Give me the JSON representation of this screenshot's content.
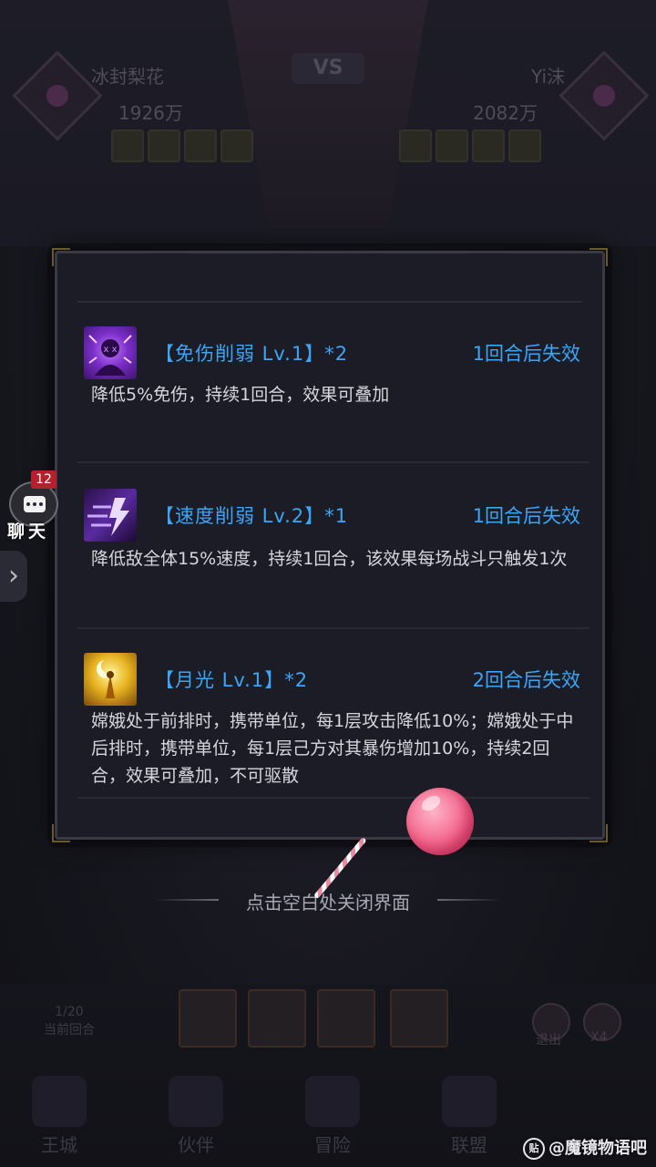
{
  "background": {
    "left_player": {
      "name": "冰封梨花",
      "power": "1926万"
    },
    "right_player": {
      "name": "Yi沫",
      "power": "2082万"
    },
    "vs_label": "VS",
    "round": {
      "count": "1/20",
      "label": "当前回合"
    },
    "controls": [
      {
        "label": "退出"
      },
      {
        "label": "X4"
      }
    ],
    "nav": [
      {
        "label": "王城"
      },
      {
        "label": "伙伴"
      },
      {
        "label": "冒险"
      },
      {
        "label": "联盟"
      }
    ]
  },
  "buffs": [
    {
      "icon": "shield-break-icon",
      "name": "【免伤削弱 Lv.1】*2",
      "duration": "1回合后失效",
      "description": "降低5%免伤，持续1回合，效果可叠加"
    },
    {
      "icon": "speed-break-icon",
      "name": "【速度削弱 Lv.2】*1",
      "duration": "1回合后失效",
      "description": "降低敌全体15%速度，持续1回合，该效果每场战斗只触发1次"
    },
    {
      "icon": "moonlight-icon",
      "name": "【月光 Lv.1】*2",
      "duration": "2回合后失效",
      "description": "嫦娥处于前排时，携带单位，每1层攻击降低10%；嫦娥处于中后排时，携带单位，每1层己方对其暴伤增加10%，持续2回合，效果可叠加，不可驱散"
    }
  ],
  "close_hint": "点击空白处关闭界面",
  "chat": {
    "label": "聊天",
    "badge": "12"
  },
  "watermark": "@魔镜物语吧",
  "colors": {
    "accent": "#3aa6f5",
    "badge": "#b61f2c",
    "panel_bg": "#1b1c26"
  }
}
